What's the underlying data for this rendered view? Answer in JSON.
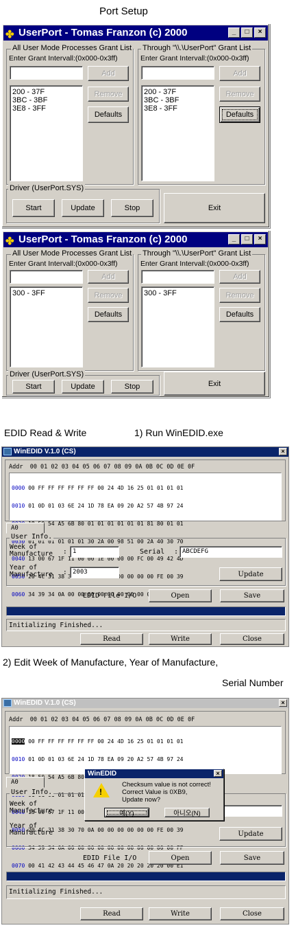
{
  "captions": {
    "port_setup": "Port Setup",
    "edid_rw": "EDID Read & Write",
    "step1": "1) Run WinEDID.exe",
    "step2": "2) Edit Week of Manufacture, Year of Manufacture,",
    "step2b": "Serial Number"
  },
  "userport": {
    "title": "UserPort - Tomas Franzon (c) 2000",
    "left_group": "All User Mode Processes Grant List",
    "right_group": "Through \"\\\\.\\UserPort\" Grant List",
    "enter_label": "Enter Grant Intervall:(0x000-0x3ff)",
    "add": "Add",
    "remove": "Remove",
    "defaults": "Defaults",
    "driver_group": "Driver (UserPort.SYS)",
    "start": "Start",
    "update": "Update",
    "stop": "Stop",
    "exit": "Exit",
    "win1": {
      "left_items": [
        "200 - 37F",
        "3BC - 3BF",
        "3E8 - 3FF"
      ],
      "right_items": [
        "200 - 37F",
        "3BC - 3BF",
        "3E8 - 3FF"
      ]
    },
    "win2": {
      "left_items": [
        "300 - 3FF"
      ],
      "right_items": [
        "300 - 3FF"
      ]
    }
  },
  "winedid": {
    "title": "WinEDID V.1.0 (CS)",
    "header": "Addr  00 01 02 03 04 05 06 07 08 09 0A 0B 0C 0D 0E 0F",
    "rows": [
      {
        "addr": "0000",
        "bytes": "00 FF FF FF FF FF FF 00 24 4D 16 25 01 01 01 01"
      },
      {
        "addr": "0010",
        "bytes": "01 0D 01 03 6E 24 1D 78 EA 09 20 A2 57 4B 97 24"
      },
      {
        "addr": "0020",
        "bytes": "18 50 54 A5 6B 80 01 01 01 01 01 01 81 80 01 01"
      },
      {
        "addr": "0030",
        "bytes": "01 01 01 01 01 01 30 2A 00 98 51 00 2A 40 30 70"
      },
      {
        "addr": "0040",
        "bytes": "13 00 67 1F 11 00 00 1E 00 00 00 FC 00 49 42 4D"
      },
      {
        "addr": "0050",
        "bytes": "20 4C 31 38 30 70 0A 00 00 00 00 00 00 FE 00 39"
      },
      {
        "addr": "0060",
        "bytes": "34 39 34 0A 00 00 00 00 00 00 00 00 00 00 00 FF"
      },
      {
        "addr": "0070",
        "bytes": "00 41 42 43 44 45 46 47 0A 20 20 20 20 20 00 E1"
      }
    ],
    "tab": "A0",
    "user_info": "User Info.",
    "week_label": "Week of\nManufacture",
    "year_label": "Year of\nManufacture",
    "colon": ":",
    "week_value": "1",
    "year_value": "2003",
    "serial_label": "Serial",
    "serial_value": "ABCDEFG",
    "update": "Update",
    "file_io": "EDID File I/O",
    "open": "Open",
    "save": "Save",
    "status": "Initializing Finished...",
    "read": "Read",
    "write": "Write",
    "close": "Close",
    "close_x": "×",
    "dialog": {
      "title": "WinEDID",
      "message": "Checksum value is not correct!\nCorrect Value is 0XB9,\nUpdate now?",
      "yes": "예(Y)",
      "no": "아니오(N)"
    }
  }
}
